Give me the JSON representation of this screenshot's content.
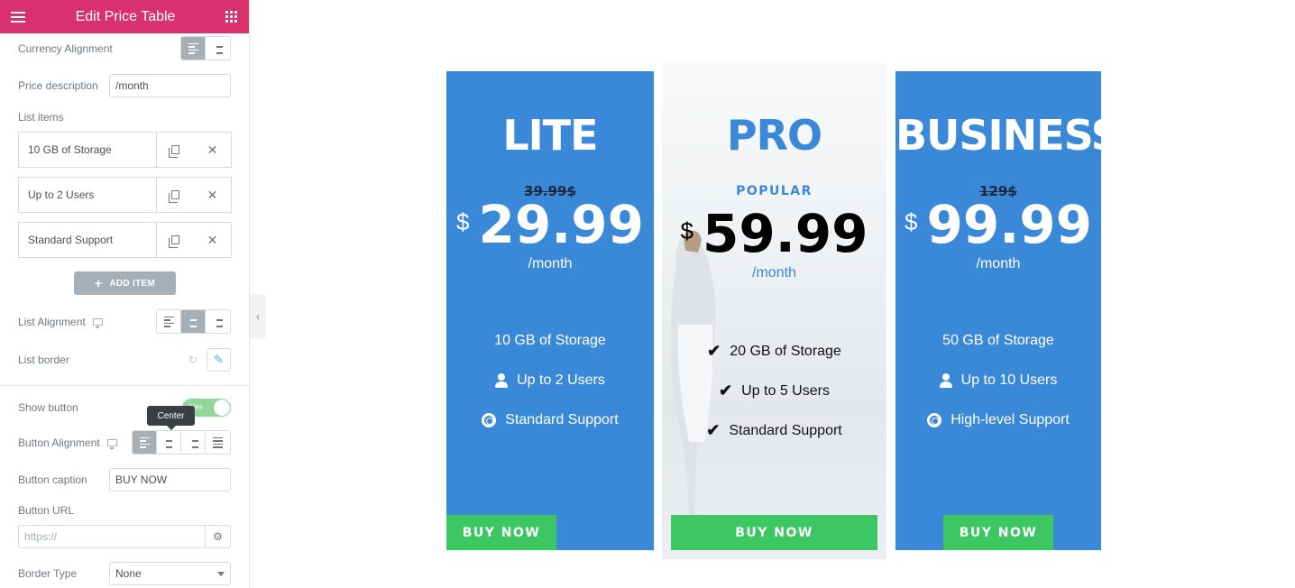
{
  "panel": {
    "title": "Edit Price Table",
    "currency_alignment_label": "Currency Alignment",
    "price_description_label": "Price description",
    "price_description_value": "/month",
    "list_items_label": "List items",
    "list_items": [
      {
        "label": "10 GB of Storage"
      },
      {
        "label": "Up to 2 Users"
      },
      {
        "label": "Standard Support"
      }
    ],
    "add_item_label": "ADD ITEM",
    "list_alignment_label": "List Alignment",
    "list_border_label": "List border",
    "show_button_label": "Show button",
    "show_button_toggle": "Yes",
    "tooltip": "Center",
    "button_alignment_label": "Button Alignment",
    "button_caption_label": "Button caption",
    "button_caption_value": "BUY NOW",
    "button_url_label": "Button URL",
    "button_url_placeholder": "https://",
    "border_type_label": "Border Type",
    "border_type_value": "None"
  },
  "plans": [
    {
      "name": "LITE",
      "old_price": "39.99$",
      "currency": "$",
      "price": "29.99",
      "period": "/month",
      "features": [
        {
          "icon": "none",
          "text": "10 GB of Storage"
        },
        {
          "icon": "user-icon",
          "text": "Up to 2 Users"
        },
        {
          "icon": "life-ring-icon",
          "text": "Standard Support"
        }
      ],
      "button": "BUY NOW"
    },
    {
      "name": "PRO",
      "badge": "POPULAR",
      "currency": "$",
      "price": "59.99",
      "period": "/month",
      "features": [
        {
          "icon": "check-icon",
          "text": "20 GB of Storage"
        },
        {
          "icon": "check-icon",
          "text": "Up to 5 Users"
        },
        {
          "icon": "check-icon",
          "text": "Standard Support"
        }
      ],
      "button": "BUY NOW"
    },
    {
      "name": "BUSINESS",
      "old_price": "129$",
      "currency": "$",
      "price": "99.99",
      "period": "/month",
      "features": [
        {
          "icon": "none",
          "text": "50 GB of Storage"
        },
        {
          "icon": "user-icon",
          "text": "Up to 10 Users"
        },
        {
          "icon": "life-ring-icon",
          "text": "High-level Support"
        }
      ],
      "button": "BUY NOW"
    }
  ],
  "colors": {
    "header": "#d8316e",
    "card_blue": "#3a89d9",
    "buy_button": "#3dc763"
  }
}
